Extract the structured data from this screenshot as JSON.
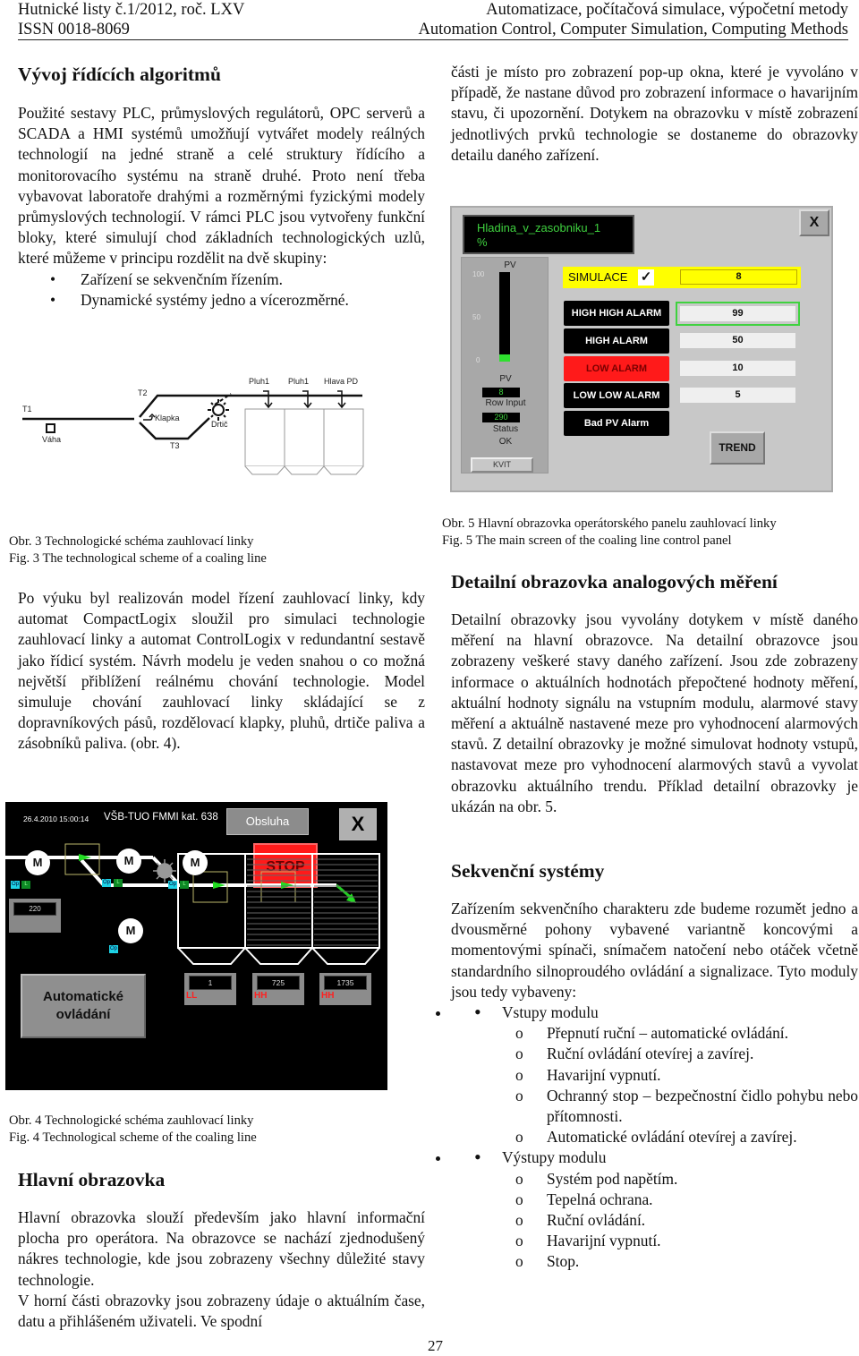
{
  "header": {
    "journal": "Hutnické listy č.1/2012, roč. LXV",
    "issn": "ISSN 0018-8069",
    "topic_cz": "Automatizace, počítačová simulace, výpočetní metody",
    "topic_en": "Automation Control, Computer Simulation, Computing Methods"
  },
  "left": {
    "section1_title": "Vývoj řídících algoritmů",
    "section1_para": "Použité sestavy PLC, průmyslových regulátorů, OPC serverů a SCADA a HMI systémů umožňují vytvářet modely reálných technologií na jedné straně a celé struktury řídícího a monitorovacího systému na straně druhé. Proto není třeba vybavovat laboratoře drahými a rozměrnými fyzickými modely průmyslových technologií. V rámci PLC jsou vytvořeny funkční bloky, které simulují chod základních technologických uzlů, které můžeme v principu rozdělit na dvě skupiny:",
    "section1_bullets": [
      "Zařízení se sekvenčním řízením.",
      "Dynamické systémy jedno a vícerozměrné."
    ],
    "fig3_caption_cz": "Obr. 3 Technologické schéma zauhlovací linky",
    "fig3_caption_en": "Fig.  3 The technological scheme of a coaling line",
    "para2": "Po výuku byl realizován model řízení zauhlovací linky, kdy automat CompactLogix sloužil pro simulaci technologie zauhlovací linky a automat ControlLogix v redundantní sestavě jako řídicí systém. Návrh modelu je veden snahou o co možná největší přiblížení reálnému chování technologie. Model simuluje chování zauhlovací linky skládající se z dopravníkových pásů, rozdělovací klapky, pluhů, drtiče paliva a zásobníků paliva. (obr. 4).",
    "fig4_caption_cz": "Obr. 4 Technologické schéma zauhlovací linky",
    "fig4_caption_en": "Fig.  4 Technological scheme of the coaling line",
    "section2_title": "Hlavní obrazovka",
    "section2_para1": "Hlavní obrazovka slouží především jako hlavní informační plocha pro operátora. Na obrazovce se nachází zjednodušený nákres technologie, kde jsou zobrazeny všechny důležité stavy technologie.",
    "section2_para2": "V horní části obrazovky jsou zobrazeny údaje o aktuálním čase, datu a přihlášeném uživateli. Ve spodní"
  },
  "fig3": {
    "labels": {
      "t1": "T1",
      "vaha": "Váha",
      "t2": "T2",
      "klapka": "Klapka",
      "t3": "T3",
      "drtic": "Drtič",
      "pluh1a": "Pluh1",
      "pluh1b": "Pluh1",
      "hlava": "Hlava PD"
    }
  },
  "fig4": {
    "datetime": "26.4.2010 15:00:14",
    "site": "VŠB-TUO FMMI kat. 638",
    "obsluha_label": "Obsluha",
    "close_label": "X",
    "stop_label": "STOP",
    "motor_label": "M",
    "tag_op": "Op",
    "tag_l": "L",
    "weigh_value": "220",
    "auto_label_1": "Automatické",
    "auto_label_2": "ovládání",
    "bins": [
      {
        "value": "1",
        "alarm": "LL"
      },
      {
        "value": "725",
        "alarm": "HH"
      },
      {
        "value": "1735",
        "alarm": "HH"
      }
    ],
    "colors": {
      "background": "#000000",
      "stop": "#ff1a1a",
      "flow_arrow": "#22dd22",
      "op_tag": "#1ed3e6",
      "l_tag": "#0d8a25",
      "alarm_text": "#ff2020"
    }
  },
  "right": {
    "para_top": "části je místo pro zobrazení pop-up okna, které je vyvoláno v případě, že nastane důvod pro zobrazení informace o havarijním stavu, či upozornění. Dotykem na obrazovku v místě zobrazení jednotlivých prvků technologie se dostaneme do obrazovky detailu daného zařízení.",
    "fig5_caption_cz": "Obr. 5 Hlavní obrazovka operátorského panelu zauhlovací linky",
    "fig5_caption_en": "Fig.  5 The main screen of the coaling line control panel",
    "section3_title": "Detailní obrazovka analogových měření",
    "section3_para": "Detailní obrazovky jsou vyvolány dotykem v místě daného měření na hlavní obrazovce. Na detailní obrazovce jsou zobrazeny veškeré stavy daného zařízení. Jsou zde zobrazeny informace o aktuálních hodnotách přepočtené hodnoty měření, aktuální hodnoty signálu na vstupním modulu, alarmové stavy měření a aktuálně nastavené meze pro vyhodnocení alarmových stavů. Z detailní obrazovky je možné simulovat hodnoty vstupů, nastavovat meze pro vyhodnocení alarmových stavů a vyvolat obrazovku aktuálního trendu. Příklad detailní obrazovky je ukázán na obr. 5.",
    "section4_title": "Sekvenční systémy",
    "section4_para": "Zařízením sekvenčního charakteru zde budeme rozumět jedno a dvousměrné pohony vybavené variantně koncovými a momentovými spínači, snímačem natočení nebo otáček včetně standardního silnoproudého ovládání a signalizace. Tyto moduly jsou tedy vybaveny:",
    "lists": [
      {
        "title": "Vstupy modulu",
        "items": [
          "Přepnutí ruční – automatické ovládání.",
          "Ruční ovládání otevírej a zavírej.",
          "Havarijní vypnutí.",
          "Ochranný stop – bezpečnostní čidlo pohybu nebo přítomnosti.",
          "Automatické ovládání otevírej a zavírej."
        ]
      },
      {
        "title": "Výstupy modulu",
        "items": [
          "Systém pod napětím.",
          "Tepelná ochrana.",
          "Ruční ovládání.",
          "Havarijní vypnutí.",
          "Stop."
        ]
      }
    ]
  },
  "fig5": {
    "tag_name": "Hladina_v_zasobniku_1",
    "unit": "%",
    "close_label": "X",
    "bar_label": "PV",
    "scale": [
      "100",
      "50",
      "0"
    ],
    "pv_fraction": 0.08,
    "pv_label": "PV",
    "pv_value": "8",
    "row_input_label": "Row Input",
    "row_input_value": "290",
    "status_label": "Status",
    "status_value": "OK",
    "kvit_label": "KVIT",
    "simulace_label": "SIMULACE",
    "simulace_checked": "✓",
    "simulace_value": "8",
    "alarms": [
      {
        "label": "HIGH HIGH ALARM",
        "value": "99",
        "active": false,
        "selected": true
      },
      {
        "label": "HIGH ALARM",
        "value": "50",
        "active": false,
        "selected": false
      },
      {
        "label": "LOW ALARM",
        "value": "10",
        "active": true,
        "selected": false
      },
      {
        "label": "LOW LOW ALARM",
        "value": "5",
        "active": false,
        "selected": false
      },
      {
        "label": "Bad PV Alarm",
        "value": null,
        "active": false,
        "selected": false
      }
    ],
    "trend_label": "TREND",
    "colors": {
      "panel": "#c8c8c8",
      "title_text": "#3fd23f",
      "simulace_bg": "#ffff00",
      "alarm_active": "#ff1a1a",
      "bar_fill": "#2ee02e"
    }
  },
  "page_number": "27"
}
